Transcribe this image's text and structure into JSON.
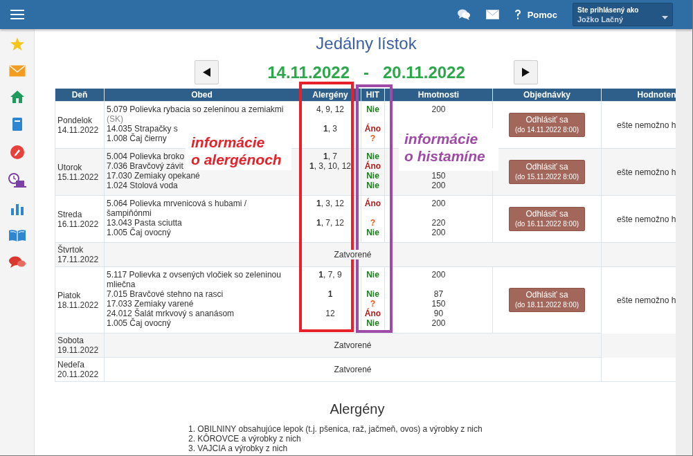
{
  "top_bar": {
    "help": "Pomoc",
    "user_label": "Ste prihlásený ako",
    "user_name": "Jožko Lačný"
  },
  "title": "Jedálny lístok",
  "week": {
    "from": "14.11.2022",
    "separator": "-",
    "to": "20.11.2022"
  },
  "table": {
    "columns": [
      "Deň",
      "Obed",
      "Alergény",
      "HIT",
      "Hmotnosti",
      "Objednávky",
      "Hodnoten"
    ],
    "rows": [
      {
        "day": "Pondelok",
        "date": "14.11.2022",
        "closed": false,
        "order": {
          "label": "Odhlásiť sa",
          "deadline": "(do 14.11.2022 8:00)"
        },
        "rating": "ešte nemožno h",
        "meals": [
          {
            "name": "5.079 Polievka rybacia so zeleninou a zemiakmi",
            "note": "(SK)",
            "allergens": "4, 9, 12",
            "hit": {
              "text": "Nie",
              "kind": "no"
            },
            "weight": "200"
          },
          {
            "name": "14.035 Strapačky s",
            "allergens": "**1**, 3",
            "hit": {
              "text": "Áno",
              "kind": "yes"
            }
          },
          {
            "name": "1.008 Čaj čierny",
            "hit": {
              "text": "?",
              "kind": "unknown"
            }
          }
        ]
      },
      {
        "day": "Utorok",
        "date": "15.11.2022",
        "closed": false,
        "order": {
          "label": "Odhlásiť sa",
          "deadline": "(do 15.11.2022 8:00)"
        },
        "rating": "ešte nemožno h",
        "meals": [
          {
            "name": "5.004 Polievka broko",
            "allergens": "**1**, 7",
            "hit": {
              "text": "Nie",
              "kind": "no"
            }
          },
          {
            "name": "7.036 Bravčový závit",
            "allergens": "**1**, 3, 10, 12",
            "hit": {
              "text": "Áno",
              "kind": "yes"
            }
          },
          {
            "name": "17.030 Zemiaky opekané",
            "hit": {
              "text": "Nie",
              "kind": "no"
            },
            "weight": "150"
          },
          {
            "name": "1.024 Stolová voda",
            "hit": {
              "text": "Nie",
              "kind": "no"
            },
            "weight": "200"
          }
        ]
      },
      {
        "day": "Streda",
        "date": "16.11.2022",
        "closed": false,
        "order": {
          "label": "Odhlásiť sa",
          "deadline": "(do 16.11.2022 8:00)"
        },
        "rating": "ešte nemožno h",
        "meals": [
          {
            "name": "5.064 Polievka mrvenicová s hubami / šampiňónmi",
            "allergens": "**1**, 3, 12",
            "hit": {
              "text": "Áno",
              "kind": "yes"
            },
            "weight": "200"
          },
          {
            "name": "13.043 Pasta sciutta",
            "allergens": "**1**, 7, 12",
            "hit": {
              "text": "?",
              "kind": "unknown"
            },
            "weight": "220"
          },
          {
            "name": "1.005 Čaj ovocný",
            "hit": {
              "text": "Nie",
              "kind": "no"
            },
            "weight": "200"
          }
        ]
      },
      {
        "day": "Štvrtok",
        "date": "17.11.2022",
        "closed": true,
        "closed_text": "Zatvorené"
      },
      {
        "day": "Piatok",
        "date": "18.11.2022",
        "closed": false,
        "order": {
          "label": "Odhlásiť sa",
          "deadline": "(do 18.11.2022 8:00)"
        },
        "rating": "ešte nemožno h",
        "meals": [
          {
            "name": "5.117 Polievka z ovsených vločiek so zeleninou mliečna",
            "allergens": "**1**, 7, 9",
            "hit": {
              "text": "Nie",
              "kind": "no"
            },
            "weight": "200"
          },
          {
            "name": "7.015 Bravčové stehno na rasci",
            "allergens": "**1**",
            "hit": {
              "text": "Nie",
              "kind": "no"
            },
            "weight": "87"
          },
          {
            "name": "17.033 Zemiaky varené",
            "hit": {
              "text": "?",
              "kind": "unknown"
            },
            "weight": "150"
          },
          {
            "name": "24.012 Šalát mrkvový s ananásom",
            "allergens": "12",
            "hit": {
              "text": "Áno",
              "kind": "yes"
            },
            "weight": "90"
          },
          {
            "name": "1.005 Čaj ovocný",
            "hit": {
              "text": "Nie",
              "kind": "no"
            },
            "weight": "200"
          }
        ]
      },
      {
        "day": "Sobota",
        "date": "19.11.2022",
        "closed": true,
        "closed_text": "Zatvorené"
      },
      {
        "day": "Nedeľa",
        "date": "20.11.2022",
        "closed": true,
        "closed_text": "Zatvorené"
      }
    ]
  },
  "allergen_legend": {
    "title": "Alergény",
    "items": [
      "1. OBILNINY obsahujúce lepok (t.j. pšenica, raž, jačmeň, ovos) a výrobky z nich",
      "2. KÔROVCE a výrobky z nich",
      "3. VAJCIA a výrobky z nich"
    ]
  },
  "annotations": [
    {
      "kind": "allergens",
      "label": "informácie\no alergénoch",
      "color": "#e8202a"
    },
    {
      "kind": "histamine",
      "label": "informácie\no histamíne",
      "color": "#a04aa8"
    }
  ]
}
